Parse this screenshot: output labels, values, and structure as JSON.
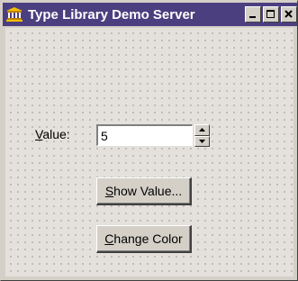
{
  "window": {
    "title": "Type Library Demo Server",
    "icon": "bank-building-icon",
    "title_bar_color": "#4b3f7f",
    "controls": [
      "minimize",
      "maximize",
      "close"
    ]
  },
  "form": {
    "value_label": {
      "mnemonic": "V",
      "rest": "alue:"
    },
    "value_input": {
      "value": "5"
    },
    "spinner_icons": [
      "spin-up-arrow-icon",
      "spin-down-arrow-icon"
    ]
  },
  "buttons": {
    "show_value": {
      "mnemonic": "S",
      "rest": "how Value..."
    },
    "change_color": {
      "mnemonic": "C",
      "rest": "hange Color"
    }
  },
  "colors": {
    "client_background": "#e4e0db",
    "grid_dots": "#a8a4a0",
    "face": "#d4d0c8"
  }
}
